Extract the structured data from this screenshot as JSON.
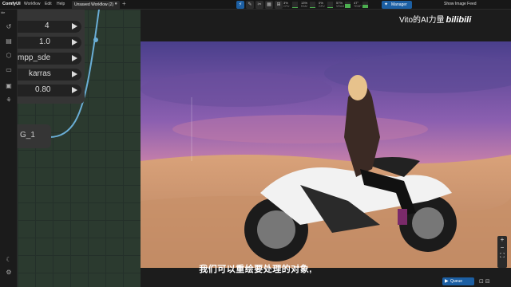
{
  "app": {
    "brand": "ComfyUI",
    "menus": [
      "Workflow",
      "Edit",
      "Help"
    ],
    "tab_title": "Unsaved Workflow (2)",
    "tab_close": "●",
    "new_tab": "+",
    "left_label": "ide"
  },
  "toolbar": {
    "tools": [
      {
        "icon": "bolt-icon",
        "glyph": "⚡",
        "active": true
      },
      {
        "icon": "eraser-icon",
        "glyph": "✎",
        "active": false
      },
      {
        "icon": "brush-icon",
        "glyph": "✂",
        "active": false
      },
      {
        "icon": "layers-icon",
        "glyph": "▦",
        "active": false
      },
      {
        "icon": "grid-icon",
        "glyph": "⊞",
        "active": false
      }
    ],
    "meters": [
      {
        "name": "CPU",
        "value": "3%",
        "level": 0.03,
        "color": "#4caf50"
      },
      {
        "name": "RAM",
        "value": "13%",
        "level": 0.13,
        "color": "#4caf50"
      },
      {
        "name": "GPU",
        "value": "0%",
        "level": 0.0,
        "color": "#4caf50"
      },
      {
        "name": "VRAM",
        "value": "57%",
        "level": 0.57,
        "color": "#4caf50"
      },
      {
        "name": "TEMP",
        "value": "47°",
        "level": 0.47,
        "color": "#4caf50"
      }
    ],
    "manager_label": "Manager",
    "manager_icon": "puzzle-icon",
    "feed_label": "Show Image Feed"
  },
  "sidebar": {
    "icons": [
      {
        "name": "history-icon",
        "glyph": "↺"
      },
      {
        "name": "queue-icon",
        "glyph": "▤"
      },
      {
        "name": "cube-icon",
        "glyph": "⬡"
      },
      {
        "name": "folder-icon",
        "glyph": "▭"
      },
      {
        "name": "image-icon",
        "glyph": "▣"
      },
      {
        "name": "nodes-icon",
        "glyph": "⚘"
      }
    ],
    "bottom_icons": [
      {
        "name": "theme-icon",
        "glyph": "☾"
      },
      {
        "name": "settings-icon",
        "glyph": "⚙"
      }
    ]
  },
  "node": {
    "widgets": [
      "4",
      "1.0",
      "mpp_sde",
      "karras",
      "0.80"
    ],
    "second_label": "G_1"
  },
  "overlay": {
    "watermark_text": "Vito的AI力量",
    "watermark_logo": "bilibili",
    "subtitle": "我们可以重绘要处理的对象,"
  },
  "bottom": {
    "queue_label": "Queue",
    "zoom_in": "+",
    "zoom_out": "−",
    "fit": "⛶",
    "extra_icons": "⊡ ⊟"
  },
  "colors": {
    "accent": "#1c5fa3",
    "wire": "#6aaed6"
  }
}
